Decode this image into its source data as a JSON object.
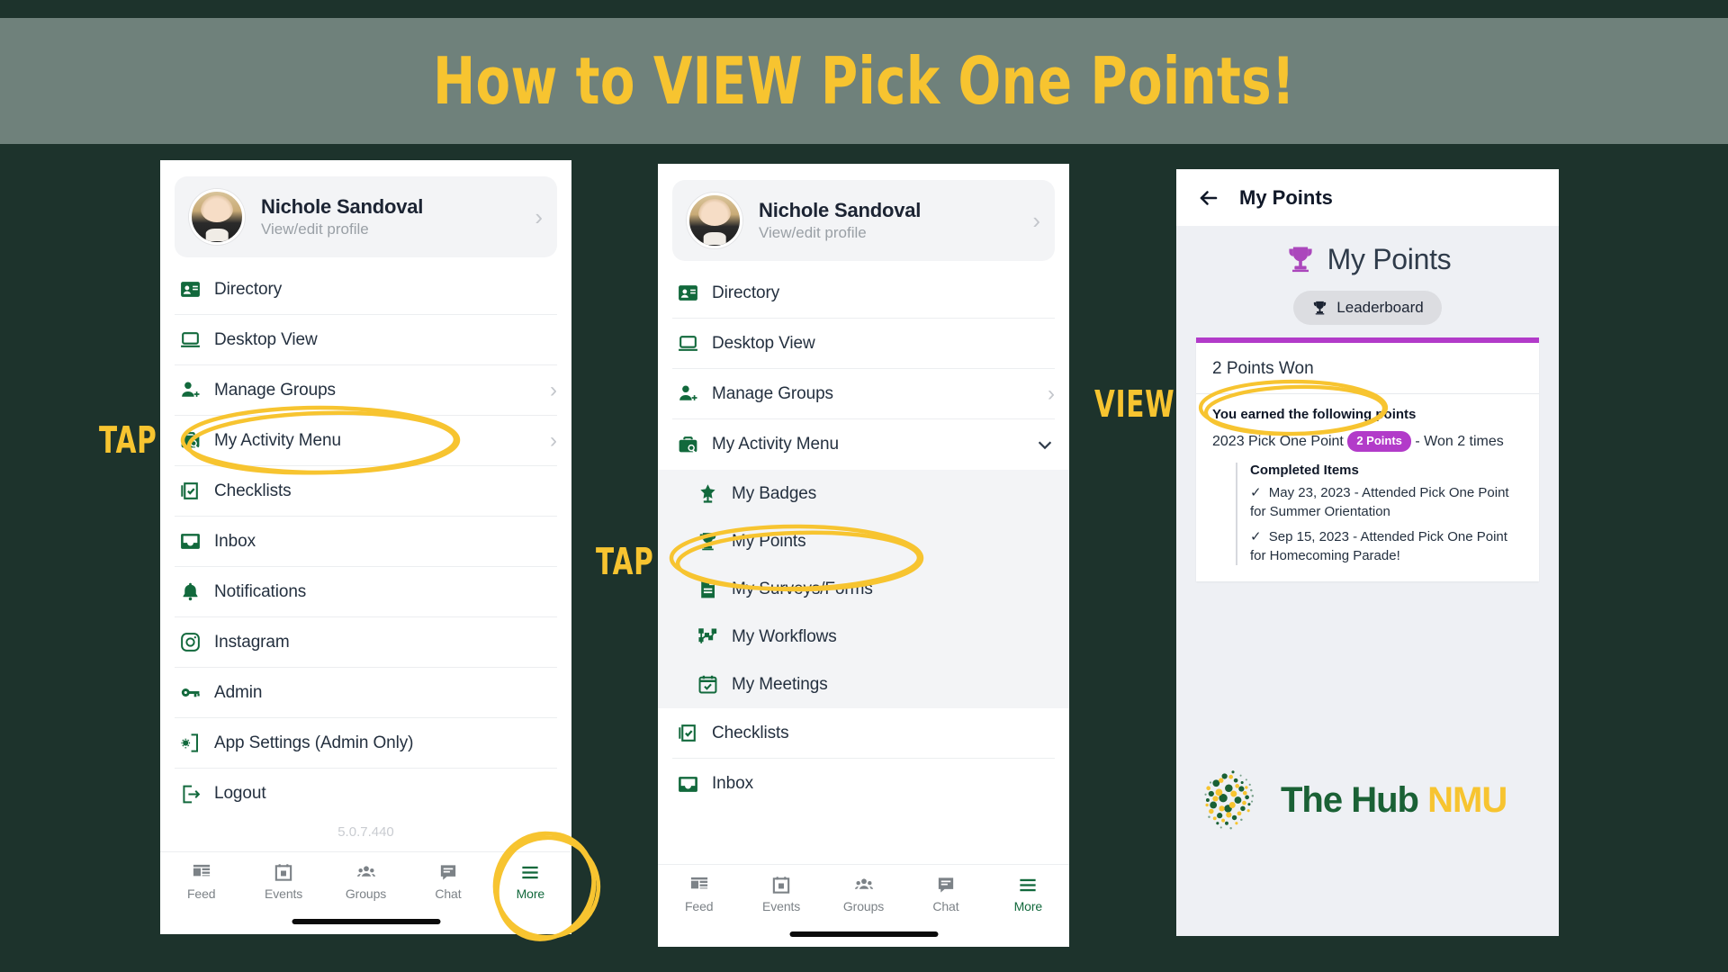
{
  "banner": {
    "title": "How to VIEW Pick One Points!",
    "bg": "#6f817b",
    "text_color": "#f7c430"
  },
  "colors": {
    "background": "#1d332c",
    "brand_green": "#12693c",
    "gold": "#f7c430",
    "purple": "#b23bc9"
  },
  "profile": {
    "name": "Nichole Sandoval",
    "subtitle": "View/edit profile",
    "chevron": "chevron-right"
  },
  "panel1": {
    "menu": [
      {
        "label": "Directory",
        "icon": "contact-card-icon",
        "chevron": ""
      },
      {
        "label": "Desktop View",
        "icon": "laptop-icon",
        "chevron": ""
      },
      {
        "label": "Manage Groups",
        "icon": "person-add-icon",
        "chevron": "›"
      },
      {
        "label": "My Activity Menu",
        "icon": "briefcase-search-icon",
        "chevron": "›"
      },
      {
        "label": "Checklists",
        "icon": "checklist-icon",
        "chevron": ""
      },
      {
        "label": "Inbox",
        "icon": "inbox-icon",
        "chevron": ""
      },
      {
        "label": "Notifications",
        "icon": "bell-icon",
        "chevron": ""
      },
      {
        "label": "Instagram",
        "icon": "instagram-icon",
        "chevron": ""
      },
      {
        "label": "Admin",
        "icon": "key-icon",
        "chevron": ""
      },
      {
        "label": "App Settings (Admin Only)",
        "icon": "app-settings-icon",
        "chevron": ""
      },
      {
        "label": "Logout",
        "icon": "logout-icon",
        "chevron": ""
      }
    ],
    "version": "5.0.7.440"
  },
  "panel2": {
    "menu_top": [
      {
        "label": "Directory",
        "icon": "contact-card-icon",
        "chevron": ""
      },
      {
        "label": "Desktop View",
        "icon": "laptop-icon",
        "chevron": ""
      },
      {
        "label": "Manage Groups",
        "icon": "person-add-icon",
        "chevron": "›"
      },
      {
        "label": "My Activity Menu",
        "icon": "briefcase-search-icon",
        "chevron": "down"
      }
    ],
    "submenu": [
      {
        "label": "My Badges",
        "icon": "badge-star-icon"
      },
      {
        "label": "My Points",
        "icon": "trophy-icon"
      },
      {
        "label": "My Surveys/Forms",
        "icon": "document-lines-icon"
      },
      {
        "label": "My Workflows",
        "icon": "workflow-icon"
      },
      {
        "label": "My Meetings",
        "icon": "calendar-check-icon"
      }
    ],
    "menu_bottom": [
      {
        "label": "Checklists",
        "icon": "checklist-icon",
        "chevron": ""
      },
      {
        "label": "Inbox",
        "icon": "inbox-icon",
        "chevron": ""
      }
    ]
  },
  "tabbar": {
    "tabs": [
      {
        "label": "Feed",
        "icon": "feed-icon",
        "active": false
      },
      {
        "label": "Events",
        "icon": "calendar-icon",
        "active": false
      },
      {
        "label": "Groups",
        "icon": "groups-icon",
        "active": false
      },
      {
        "label": "Chat",
        "icon": "chat-icon",
        "active": false
      },
      {
        "label": "More",
        "icon": "hamburger-icon",
        "active": true
      }
    ]
  },
  "panel3": {
    "header_title": "My Points",
    "page_title": "My Points",
    "leaderboard_label": "Leaderboard",
    "points_won": "2 Points Won",
    "earned_title": "You earned the following points",
    "earned_item_prefix": "2023 Pick One Point",
    "earned_badge": "2 Points",
    "earned_item_suffix": "- Won 2 times",
    "completed_title": "Completed Items",
    "completed_items": [
      "May 23, 2023 - Attended Pick One Point for Summer Orientation",
      "Sep 15, 2023 - Attended Pick One Point for Homecoming Parade!"
    ],
    "logo": {
      "part1": "The Hub",
      "part2": "NMU"
    }
  },
  "annotations": {
    "tap1": "TAP",
    "tap2": "TAP",
    "view": "VIEW"
  }
}
